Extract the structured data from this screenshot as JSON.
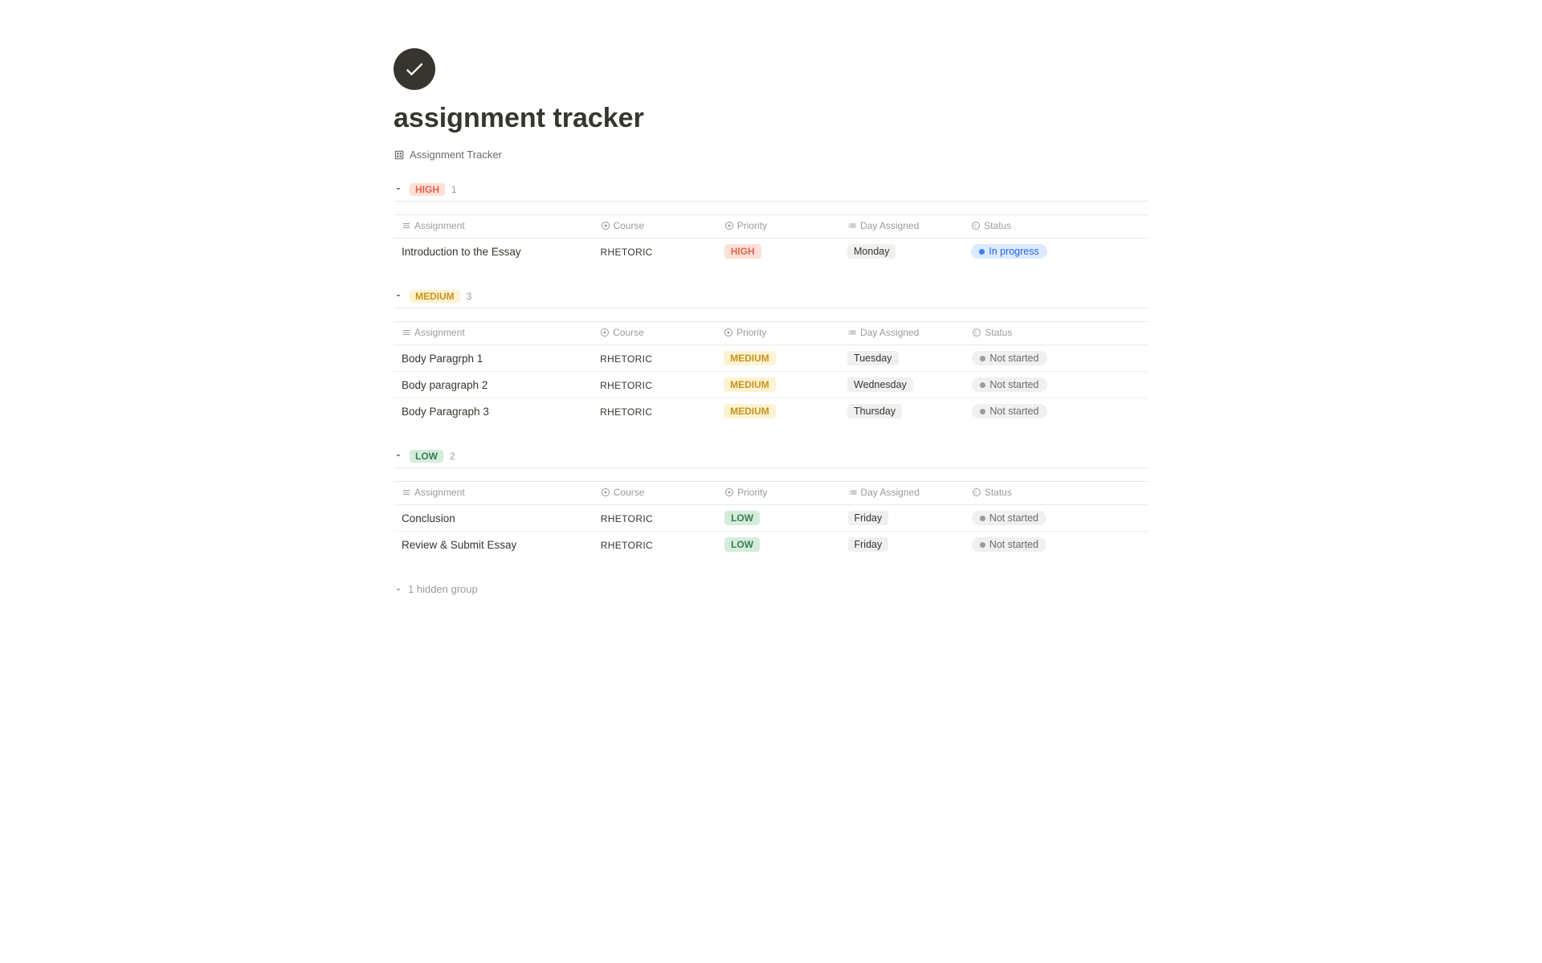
{
  "page": {
    "icon_label": "checkmark-icon",
    "title": "assignment tracker",
    "view_label": "Assignment Tracker"
  },
  "groups": [
    {
      "id": "high",
      "badge": "HIGH",
      "badge_class": "badge-high",
      "count": "1",
      "columns": [
        {
          "icon": "text-icon",
          "label": "Assignment"
        },
        {
          "icon": "circle-icon",
          "label": "Course"
        },
        {
          "icon": "circle-icon",
          "label": "Priority"
        },
        {
          "icon": "list-icon",
          "label": "Day Assigned"
        },
        {
          "icon": "spinner-icon",
          "label": "Status"
        }
      ],
      "rows": [
        {
          "assignment": "Introduction to the Essay",
          "course": "RHETORIC",
          "priority": "HIGH",
          "priority_class": "priority-high",
          "day": "Monday",
          "status": "In progress",
          "status_class": "status-inprogress",
          "dot_class": "dot-inprogress"
        }
      ]
    },
    {
      "id": "medium",
      "badge": "MEDIUM",
      "badge_class": "badge-medium",
      "count": "3",
      "columns": [
        {
          "icon": "text-icon",
          "label": "Assignment"
        },
        {
          "icon": "circle-icon",
          "label": "Course"
        },
        {
          "icon": "circle-icon",
          "label": "Priority"
        },
        {
          "icon": "list-icon",
          "label": "Day Assigned"
        },
        {
          "icon": "spinner-icon",
          "label": "Status"
        }
      ],
      "rows": [
        {
          "assignment": "Body Paragrph 1",
          "course": "RHETORIC",
          "priority": "MEDIUM",
          "priority_class": "priority-medium",
          "day": "Tuesday",
          "status": "Not started",
          "status_class": "status-notstarted",
          "dot_class": "dot-notstarted"
        },
        {
          "assignment": "Body paragraph 2",
          "course": "RHETORIC",
          "priority": "MEDIUM",
          "priority_class": "priority-medium",
          "day": "Wednesday",
          "status": "Not started",
          "status_class": "status-notstarted",
          "dot_class": "dot-notstarted"
        },
        {
          "assignment": "Body Paragraph 3",
          "course": "RHETORIC",
          "priority": "MEDIUM",
          "priority_class": "priority-medium",
          "day": "Thursday",
          "status": "Not started",
          "status_class": "status-notstarted",
          "dot_class": "dot-notstarted"
        }
      ]
    },
    {
      "id": "low",
      "badge": "LOW",
      "badge_class": "badge-low",
      "count": "2",
      "columns": [
        {
          "icon": "text-icon",
          "label": "Assignment"
        },
        {
          "icon": "circle-icon",
          "label": "Course"
        },
        {
          "icon": "circle-icon",
          "label": "Priority"
        },
        {
          "icon": "list-icon",
          "label": "Day Assigned"
        },
        {
          "icon": "spinner-icon",
          "label": "Status"
        }
      ],
      "rows": [
        {
          "assignment": "Conclusion",
          "course": "RHETORIC",
          "priority": "LOW",
          "priority_class": "priority-low",
          "day": "Friday",
          "status": "Not started",
          "status_class": "status-notstarted",
          "dot_class": "dot-notstarted"
        },
        {
          "assignment": "Review & Submit Essay",
          "course": "RHETORIC",
          "priority": "LOW",
          "priority_class": "priority-low",
          "day": "Friday",
          "status": "Not started",
          "status_class": "status-notstarted",
          "dot_class": "dot-notstarted"
        }
      ]
    }
  ],
  "hidden_group_label": "1 hidden group"
}
